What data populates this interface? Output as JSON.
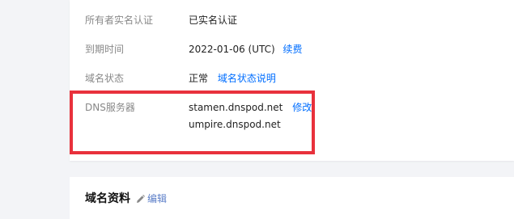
{
  "info_rows": [
    {
      "label": "所有者实名认证",
      "value": "已实名认证",
      "link": ""
    },
    {
      "label": "到期时间",
      "value": "2022-01-06 (UTC)",
      "link": "续费"
    },
    {
      "label": "域名状态",
      "value": "正常",
      "link": "域名状态说明"
    },
    {
      "label": "DNS服务器",
      "value": "stamen.dnspod.net",
      "link": "修改",
      "value2": "umpire.dnspod.net"
    }
  ],
  "section": {
    "title": "域名资料",
    "edit_label": "编辑"
  },
  "colors": {
    "link": "#006eff",
    "highlight": "#e8313c",
    "page_bg": "#f3f4f7"
  }
}
